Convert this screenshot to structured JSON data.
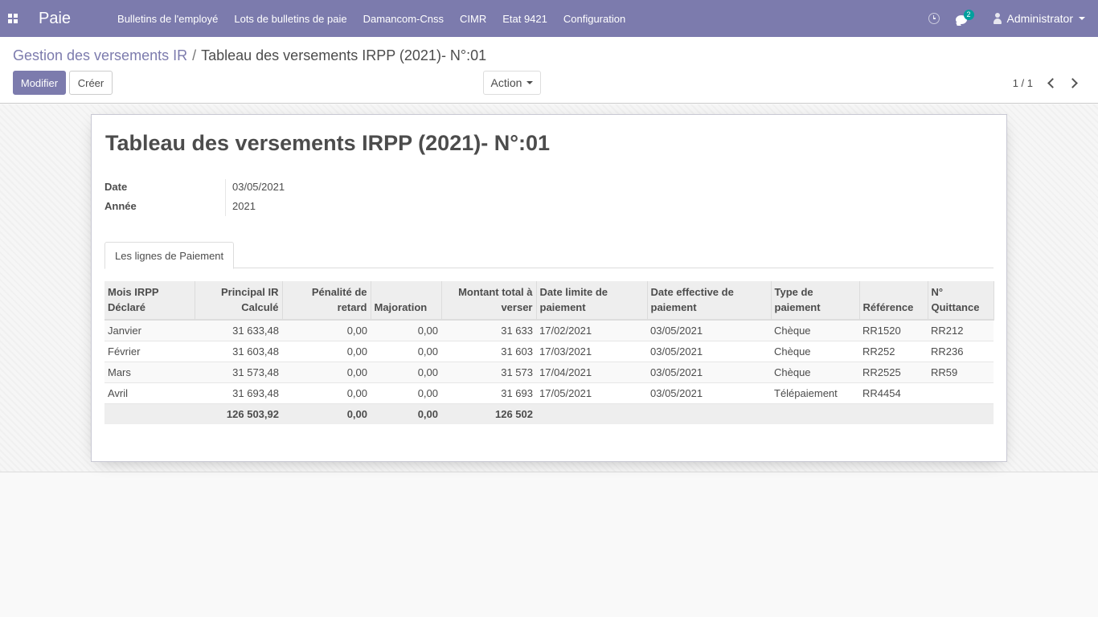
{
  "navbar": {
    "app_name": "Paie",
    "menu": [
      "Bulletins de l'employé",
      "Lots de bulletins de paie",
      "Damancom-Cnss",
      "CIMR",
      "Etat 9421",
      "Configuration"
    ],
    "message_count": "2",
    "user_name": "Administrator"
  },
  "control_panel": {
    "breadcrumb_parent": "Gestion des versements IR",
    "breadcrumb_separator": "/",
    "breadcrumb_current": "Tableau des versements IRPP (2021)- N°:01",
    "edit_button": "Modifier",
    "create_button": "Créer",
    "action_button": "Action",
    "pager": "1 / 1"
  },
  "form": {
    "title": "Tableau des versements IRPP (2021)- N°:01",
    "date_label": "Date",
    "date_value": "03/05/2021",
    "year_label": "Année",
    "year_value": "2021",
    "tab_label": "Les lignes de Paiement"
  },
  "table": {
    "headers": [
      "Mois IRPP Déclaré",
      "Principal IR Calculé",
      "Pénalité de retard",
      "Majoration",
      "Montant total à verser",
      "Date limite de paiement",
      "Date effective de paiement",
      "Type de paiement",
      "Référence",
      "N° Quittance"
    ],
    "rows": [
      [
        "Janvier",
        "31 633,48",
        "0,00",
        "0,00",
        "31 633",
        "17/02/2021",
        "03/05/2021",
        "Chèque",
        "RR1520",
        "RR212"
      ],
      [
        "Février",
        "31 603,48",
        "0,00",
        "0,00",
        "31 603",
        "17/03/2021",
        "03/05/2021",
        "Chèque",
        "RR252",
        "RR236"
      ],
      [
        "Mars",
        "31 573,48",
        "0,00",
        "0,00",
        "31 573",
        "17/04/2021",
        "03/05/2021",
        "Chèque",
        "RR2525",
        "RR59"
      ],
      [
        "Avril",
        "31 693,48",
        "0,00",
        "0,00",
        "31 693",
        "17/05/2021",
        "03/05/2021",
        "Télépaiement",
        "RR4454",
        ""
      ]
    ],
    "totals": [
      "",
      "126 503,92",
      "0,00",
      "0,00",
      "126 502",
      "",
      "",
      "",
      "",
      ""
    ]
  }
}
